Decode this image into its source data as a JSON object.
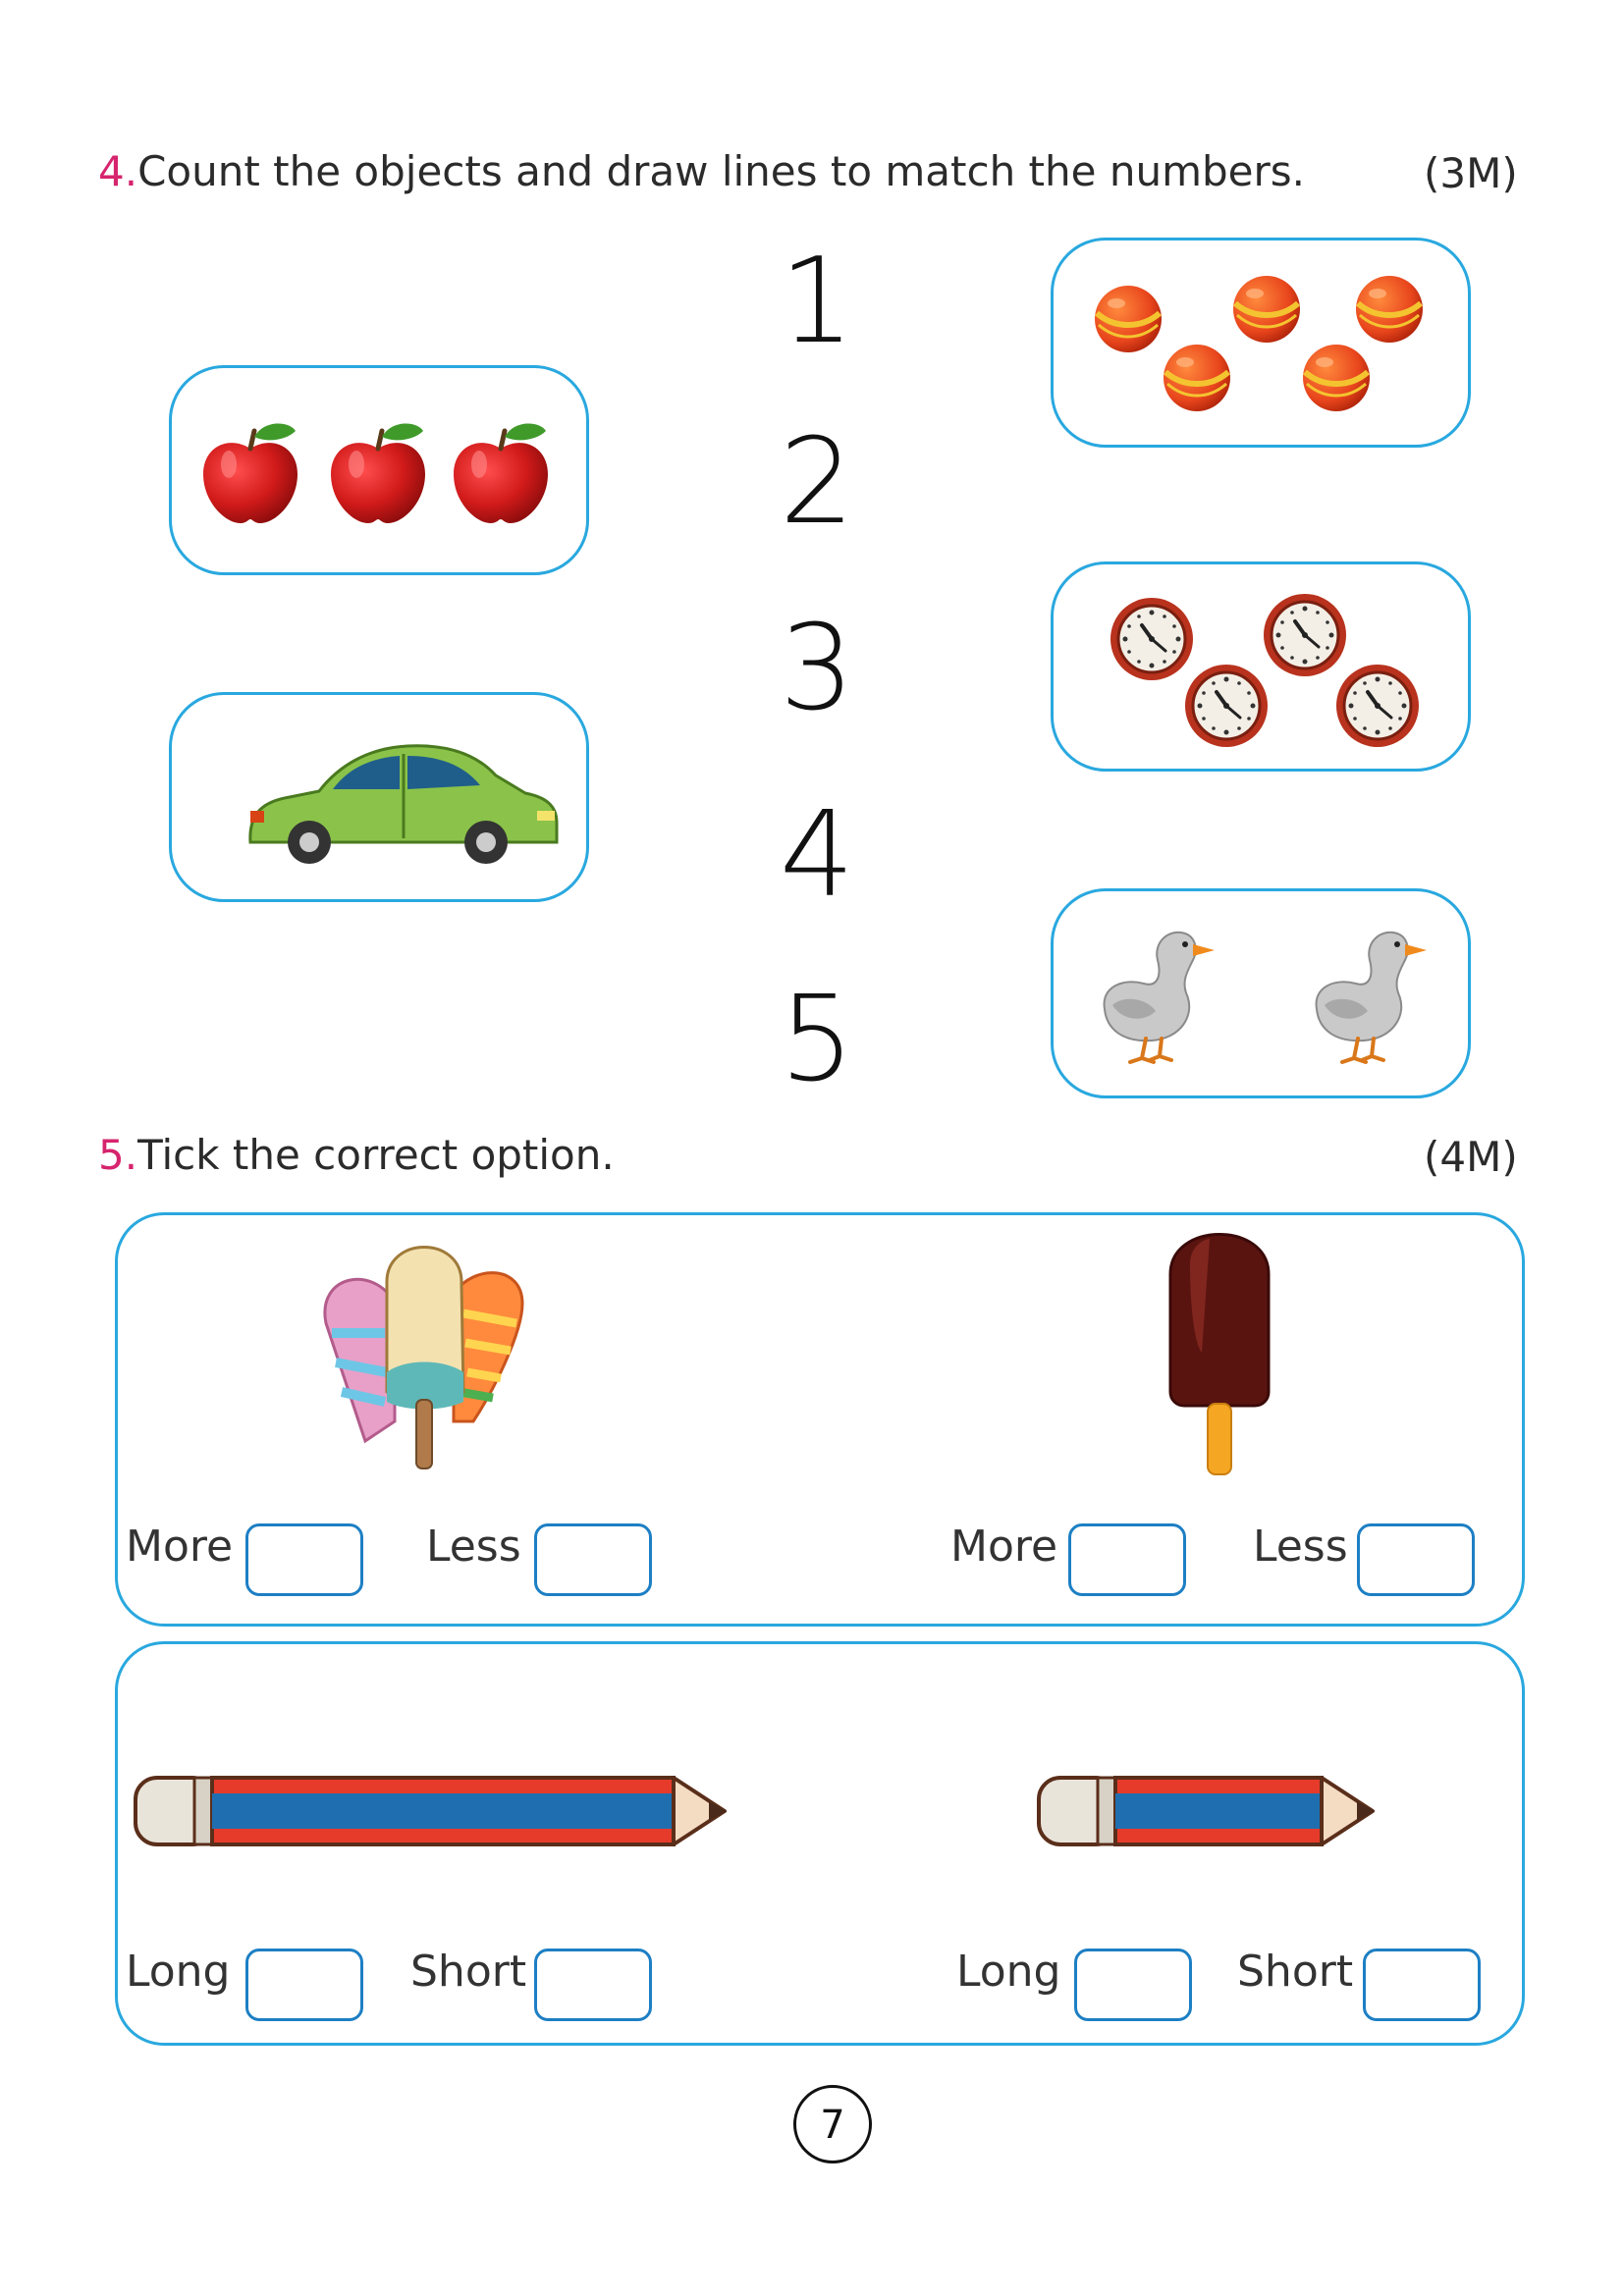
{
  "question4": {
    "number": "4.",
    "text": "Count the objects and draw lines to match the numbers.",
    "marks": "(3M)",
    "numbers": [
      "1",
      "2",
      "3",
      "4",
      "5"
    ],
    "left_boxes": [
      {
        "object": "apple",
        "count": 3
      },
      {
        "object": "car",
        "count": 1
      }
    ],
    "right_boxes": [
      {
        "object": "ball",
        "count": 5
      },
      {
        "object": "clock",
        "count": 4
      },
      {
        "object": "duck",
        "count": 2
      }
    ]
  },
  "question5": {
    "number": "5.",
    "text": "Tick the correct option.",
    "marks": "(4M)",
    "row1": {
      "left_object": "three ice-creams",
      "right_object": "one ice-cream",
      "left_options": [
        "More",
        "Less"
      ],
      "right_options": [
        "More",
        "Less"
      ]
    },
    "row2": {
      "left_object": "long pencil",
      "right_object": "short pencil",
      "left_options": [
        "Long",
        "Short"
      ],
      "right_options": [
        "Long",
        "Short"
      ]
    }
  },
  "page_number": "7",
  "colors": {
    "border_blue": "#29a8df",
    "question_pink": "#d6246e",
    "tick_box_blue": "#1d7fc4"
  }
}
